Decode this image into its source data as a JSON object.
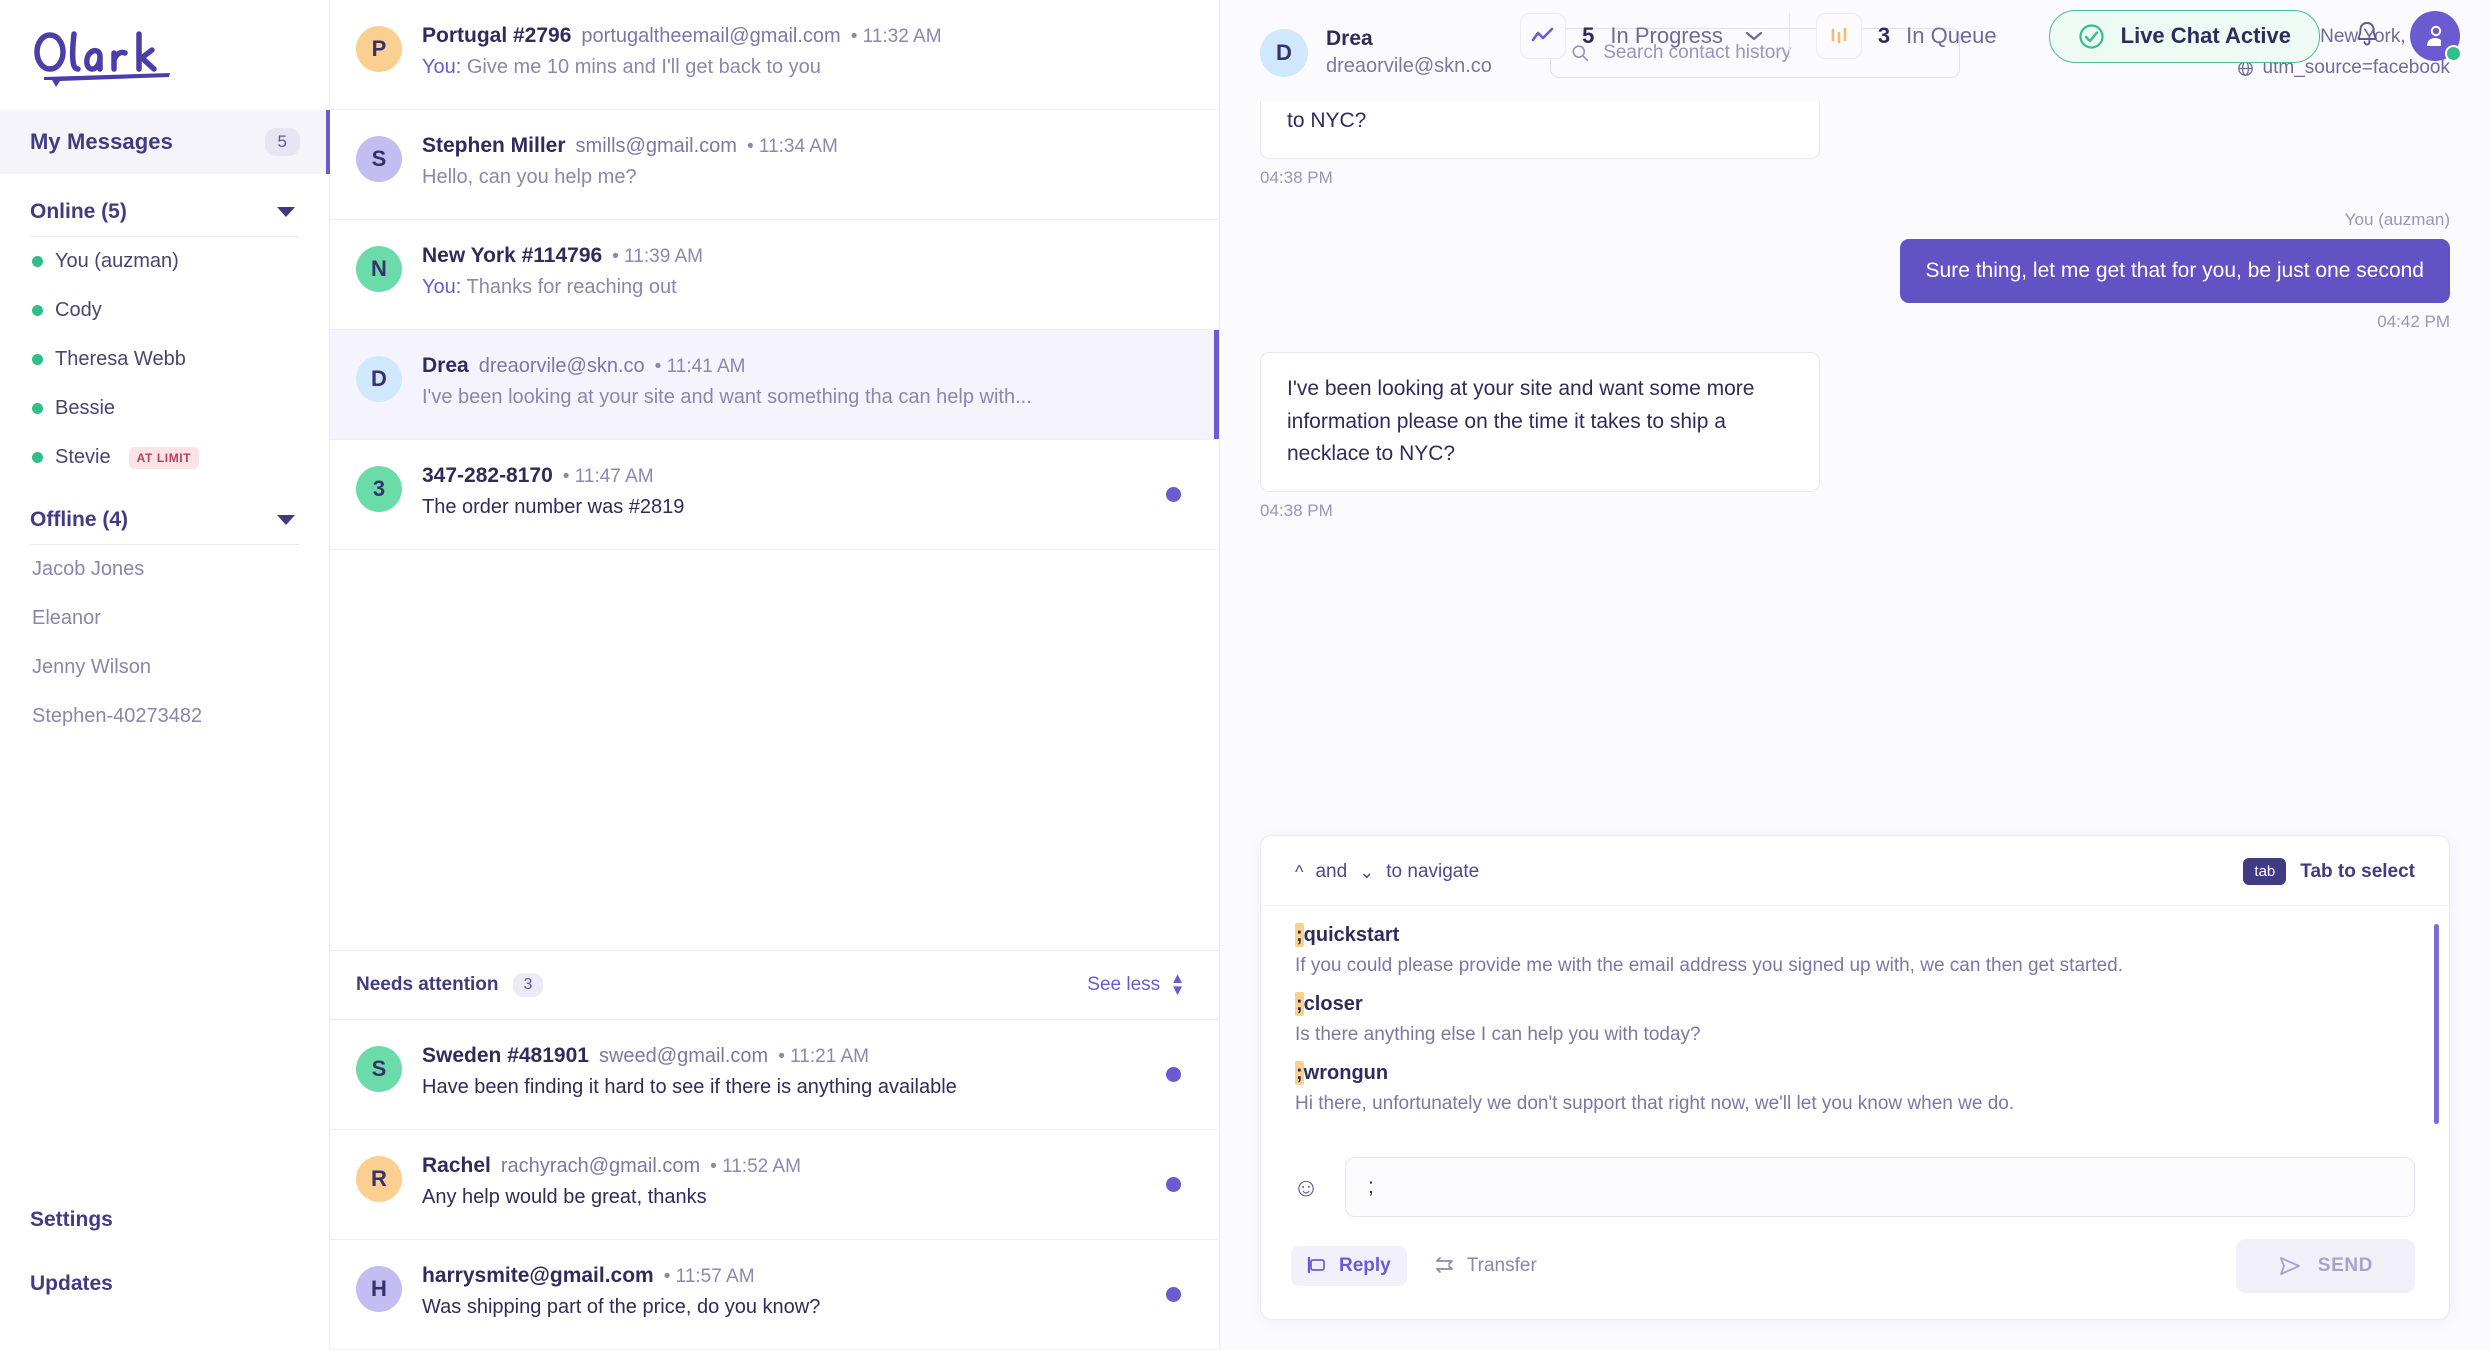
{
  "brand": {
    "name": "Olark",
    "accent": "#6a5bd0",
    "green": "#2fbf87",
    "orange": "#fbd08a"
  },
  "topbar": {
    "in_progress": {
      "count": "5",
      "label": "In Progress",
      "icon": "line-chart-icon"
    },
    "in_queue": {
      "count": "3",
      "label": "In Queue",
      "icon": "bar-chart-icon"
    },
    "status": {
      "label": "Live Chat Active",
      "icon": "check-circle-icon"
    },
    "notifications_icon": "bell-icon",
    "account_icon": "user-avatar-icon"
  },
  "sidebar": {
    "my_messages": {
      "label": "My Messages",
      "count": "5"
    },
    "online": {
      "title": "Online (5)",
      "people": [
        {
          "name": "You (auzman)",
          "badge": ""
        },
        {
          "name": "Cody",
          "badge": ""
        },
        {
          "name": "Theresa Webb",
          "badge": ""
        },
        {
          "name": "Bessie",
          "badge": ""
        },
        {
          "name": "Stevie",
          "badge": "AT LIMIT"
        }
      ]
    },
    "offline": {
      "title": "Offline (4)",
      "people": [
        {
          "name": "Jacob Jones"
        },
        {
          "name": "Eleanor"
        },
        {
          "name": "Jenny Wilson"
        },
        {
          "name": "Stephen-40273482"
        }
      ]
    },
    "footer": {
      "settings": "Settings",
      "updates": "Updates"
    }
  },
  "conversations": {
    "items": [
      {
        "initial": "P",
        "color": "#fbcf8f",
        "name": "Portugal #2796",
        "email": "portugaltheemail@gmail.com",
        "time": "11:32 AM",
        "you_prefix": "You:",
        "preview": "Give me 10 mins and I'll get back to you",
        "unread": false,
        "selected": false
      },
      {
        "initial": "S",
        "color": "#c3bdf2",
        "name": "Stephen Miller",
        "email": "smills@gmail.com",
        "time": "11:34 AM",
        "you_prefix": "",
        "preview": "Hello, can you help me?",
        "unread": false,
        "selected": false
      },
      {
        "initial": "N",
        "color": "#6bdba9",
        "name": "New York #114796",
        "email": "",
        "time": "11:39 AM",
        "you_prefix": "You:",
        "preview": "Thanks for reaching out",
        "unread": false,
        "selected": false
      },
      {
        "initial": "D",
        "color": "#cfe8fb",
        "name": "Drea",
        "email": "dreaorvile@skn.co",
        "time": "11:41 AM",
        "you_prefix": "",
        "preview": "I've been looking at your site and want something tha can help with...",
        "unread": false,
        "selected": true
      },
      {
        "initial": "3",
        "color": "#6bdba9",
        "name": "347-282-8170",
        "email": "",
        "time": "11:47 AM",
        "you_prefix": "",
        "preview": "The order number was #2819",
        "unread": true,
        "selected": false
      }
    ],
    "needs_attention": {
      "title": "Needs attention",
      "count": "3",
      "see_less": "See less",
      "items": [
        {
          "initial": "S",
          "color": "#6bdba9",
          "name": "Sweden #481901",
          "email": "sweed@gmail.com",
          "time": "11:21 AM",
          "preview": "Have been finding it hard to see if there is anything available",
          "unread": true
        },
        {
          "initial": "R",
          "color": "#fbcf8f",
          "name": "Rachel",
          "email": "rachyrach@gmail.com",
          "time": "11:52 AM",
          "preview": "Any help would be great, thanks",
          "unread": true
        },
        {
          "initial": "H",
          "color": "#c3bdf2",
          "name": "harrysmite@gmail.com",
          "email": "",
          "time": "11:57 AM",
          "preview": "Was shipping part of the price, do you know?",
          "unread": true
        }
      ]
    }
  },
  "chat": {
    "contact": {
      "initial": "D",
      "name": "Drea",
      "email": "dreaorvile@skn.co"
    },
    "search": {
      "placeholder": "Search contact history",
      "value": "",
      "icon": "search-icon"
    },
    "meta": {
      "location": "New York, USA",
      "location_icon": "map-pin-icon",
      "source": "utm_source=facebook",
      "source_icon": "globe-icon"
    },
    "messages": [
      {
        "dir": "in",
        "partial": true,
        "text": "to NYC?",
        "time": "04:38 PM",
        "author": ""
      },
      {
        "dir": "out",
        "partial": false,
        "text": "Sure thing, let me get that for you, be just one second",
        "time": "04:42 PM",
        "author": "You (auzman)"
      },
      {
        "dir": "in",
        "partial": false,
        "text": "I've been looking at your site and want some more information please on the time it takes to ship a necklace to NYC?",
        "time": "04:38 PM",
        "author": ""
      }
    ]
  },
  "composer": {
    "hint": {
      "up_icon": "chevron-up-icon",
      "and": "and",
      "down_icon": "chevron-down-icon",
      "navigate": "to navigate",
      "tab_key": "tab",
      "tab_label": "Tab to select"
    },
    "shortcuts": [
      {
        "semicolon": ";",
        "name": "quickstart",
        "text": "If you could please provide me with the email address you signed up with, we can then get started."
      },
      {
        "semicolon": ";",
        "name": "closer",
        "text": "Is there anything else I can help you with today?"
      },
      {
        "semicolon": ";",
        "name": "wrongun",
        "text": "Hi there, unfortunately we don't support that right now, we'll let you know when we do."
      }
    ],
    "emoji_icon": "smiley-icon",
    "input_value": ";",
    "input_placeholder": "",
    "reply": {
      "label": "Reply",
      "icon": "reply-bubble-icon"
    },
    "transfer": {
      "label": "Transfer",
      "icon": "transfer-arrows-icon"
    },
    "send": {
      "label": "SEND",
      "icon": "send-plane-icon"
    }
  }
}
